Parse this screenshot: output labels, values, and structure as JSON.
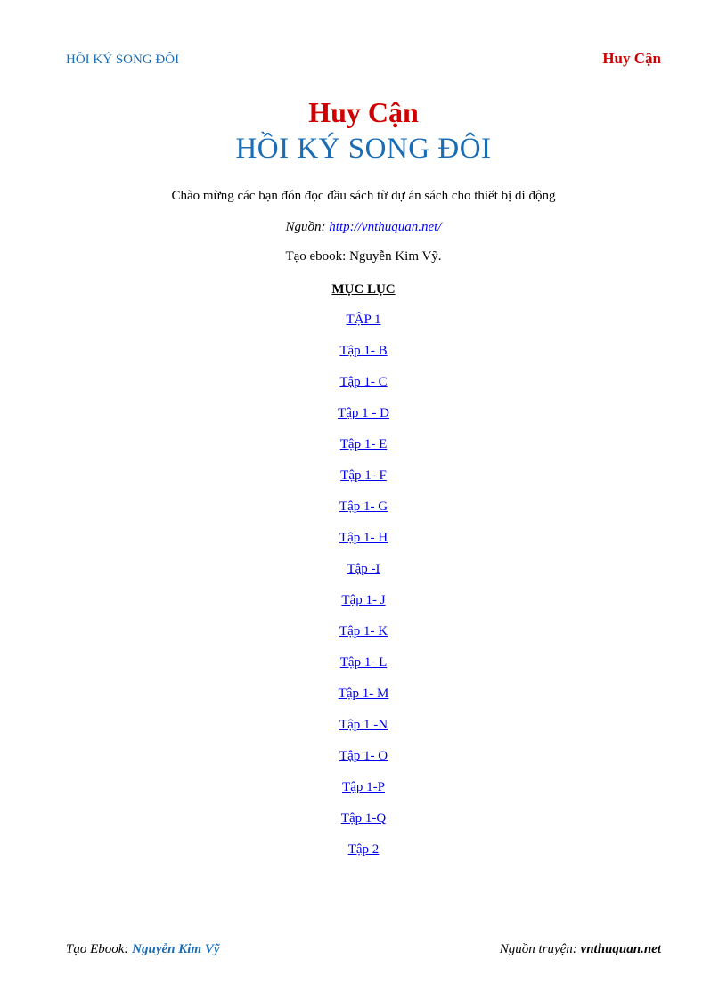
{
  "header": {
    "left": "HỒI KÝ SONG ĐÔI",
    "right": "Huy Cận"
  },
  "title": {
    "author": "Huy Cận",
    "main": "HỒI KÝ SONG ĐÔI"
  },
  "intro": "Chào mừng các bạn đón đọc đầu sách từ dự án sách cho thiết bị di động",
  "source": {
    "label": "Nguồn: ",
    "url": "http://vnthuquan.net/"
  },
  "ebook_creator": "Tạo ebook: Nguyễn Kim Vỹ.",
  "toc": {
    "heading": "MỤC LỤC",
    "items": [
      "TẬP 1",
      "Tập 1- B",
      "Tập 1- C",
      "Tập 1 - D",
      "Tập 1- E",
      "Tập 1- F",
      "Tập 1- G",
      "Tập 1- H",
      "Tập -I",
      "Tập 1- J",
      "Tập 1- K",
      "Tập 1- L",
      "Tập 1- M",
      "Tập 1 -N",
      "Tập 1- O",
      "Tập 1-P",
      "Tập 1-Q",
      "Tập 2"
    ]
  },
  "footer": {
    "left_label": "Tạo Ebook: ",
    "left_name": "Nguyễn Kim Vỹ",
    "right_label": "Nguồn truyện: ",
    "right_site": "vnthuquan.net"
  }
}
